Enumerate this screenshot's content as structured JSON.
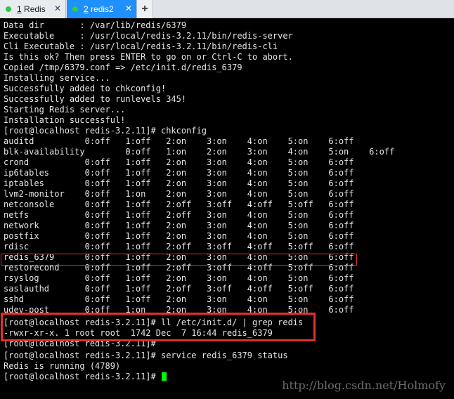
{
  "tabs": [
    {
      "number": "1",
      "title": "Redis",
      "dot_color": "#2ecc40",
      "close": "✕",
      "active": false
    },
    {
      "number": "2",
      "title": "redis2",
      "dot_color": "#2ecc40",
      "close": "✕",
      "active": true
    }
  ],
  "new_tab_label": "+",
  "colors": {
    "terminal_bg": "#000000",
    "terminal_fg": "#e6e6e6",
    "cursor": "#00ff00",
    "highlight": "#e62e2e",
    "active_tab": "#1e90ff"
  },
  "terminal": {
    "lines": [
      "Data dir       : /var/lib/redis/6379",
      "Executable     : /usr/local/redis-3.2.11/bin/redis-server",
      "Cli Executable : /usr/local/redis-3.2.11/bin/redis-cli",
      "Is this ok? Then press ENTER to go on or Ctrl-C to abort.",
      "Copied /tmp/6379.conf => /etc/init.d/redis_6379",
      "Installing service...",
      "Successfully added to chkconfig!",
      "Successfully added to runlevels 345!",
      "Starting Redis server...",
      "Installation successful!",
      "[root@localhost redis-3.2.11]# chkconfig",
      "auditd          0:off   1:off   2:on    3:on    4:on    5:on    6:off",
      "blk-availability        0:off   1:on    2:on    3:on    4:on    5:on    6:off",
      "crond           0:off   1:off   2:on    3:on    4:on    5:on    6:off",
      "ip6tables       0:off   1:off   2:on    3:on    4:on    5:on    6:off",
      "iptables        0:off   1:off   2:on    3:on    4:on    5:on    6:off",
      "lvm2-monitor    0:off   1:on    2:on    3:on    4:on    5:on    6:off",
      "netconsole      0:off   1:off   2:off   3:off   4:off   5:off   6:off",
      "netfs           0:off   1:off   2:off   3:on    4:on    5:on    6:off",
      "network         0:off   1:off   2:on    3:on    4:on    5:on    6:off",
      "postfix         0:off   1:off   2:on    3:on    4:on    5:on    6:off",
      "rdisc           0:off   1:off   2:off   3:off   4:off   5:off   6:off",
      "redis_6379      0:off   1:off   2:on    3:on    4:on    5:on    6:off",
      "restorecond     0:off   1:off   2:off   3:off   4:off   5:off   6:off",
      "rsyslog         0:off   1:off   2:on    3:on    4:on    5:on    6:off",
      "saslauthd       0:off   1:off   2:off   3:off   4:off   5:off   6:off",
      "sshd            0:off   1:off   2:on    3:on    4:on    5:on    6:off",
      "udev-post       0:off   1:on    2:on    3:on    4:on    5:on    6:off",
      "[root@localhost redis-3.2.11]# ll /etc/init.d/ | grep redis",
      "-rwxr-xr-x. 1 root root  1742 Dec  7 16:44 redis_6379",
      "[root@localhost redis-3.2.11]#",
      "[root@localhost redis-3.2.11]# service redis_6379 status",
      "Redis is running (4789)",
      "[root@localhost redis-3.2.11]# "
    ]
  },
  "watermark": "http://blog.csdn.net/Holmofy"
}
